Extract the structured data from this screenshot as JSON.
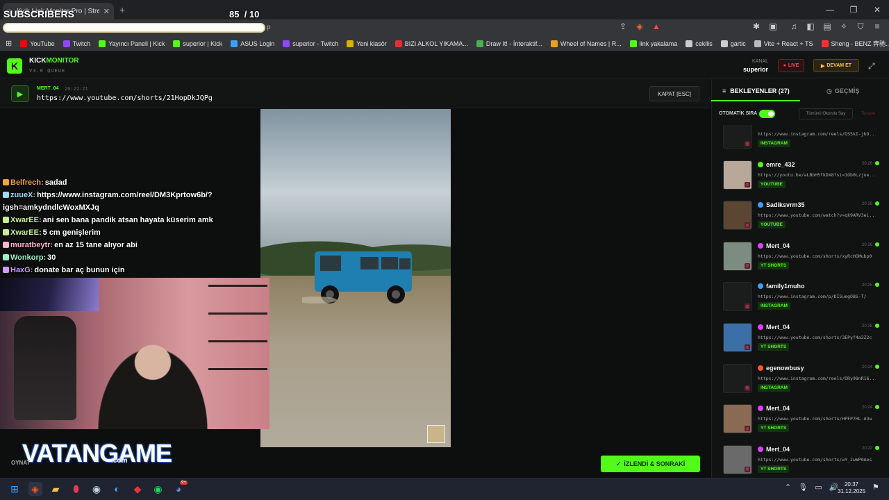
{
  "browser": {
    "tab_title": "Kick Link Monitor Pro | Strea",
    "address_tail": "p",
    "bookmarks": [
      "YouTube",
      "Twitch",
      "Yayıncı Paneli | Kick",
      "superior | Kick",
      "ASUS Login",
      "superior - Twitch",
      "Yeni klasör",
      "BIZI ALKOL YIKAMA...",
      "Draw It! - İnteraktif...",
      "Wheel of Names | R...",
      "link yakalama",
      "cekilis",
      "gartic",
      "Vite + React + TS",
      "Sheng - BENZ 奔驰..."
    ],
    "bookmark_colors": [
      "#ff0000",
      "#9146ff",
      "#53fc18",
      "#53fc18",
      "#3aa0ff",
      "#9146ff",
      "#d8b400",
      "#e03030",
      "#4caf50",
      "#e8a020",
      "#53fc18",
      "#cccccc",
      "#cccccc",
      "#bbbbbb",
      "#ff3030"
    ]
  },
  "overlay": {
    "subscribers_label": "SUBSCRIBERS",
    "subscribers_count": "85",
    "subscribers_goal": "/ 10",
    "watermark_main": "VATANGAME",
    "watermark_domain": ".com",
    "chat": [
      {
        "user": "Belfrech:",
        "msg": "sadad",
        "color": "#f3a23c"
      },
      {
        "user": "zuueX:",
        "msg": "https://www.instagram.com/reel/DM3Kprtow6b/?igsh=amkydndlcWoxMXJq",
        "color": "#9adcff"
      },
      {
        "user": "XwarEE:",
        "msg": "ani sen bana pandik atsan hayata küserim amk",
        "color": "#c8f08f"
      },
      {
        "user": "XwarEE:",
        "msg": "5 cm genişlerim",
        "color": "#c8f08f"
      },
      {
        "user": "muratbeytr:",
        "msg": "en az 15 tane alıyor abi",
        "color": "#ffb3d0"
      },
      {
        "user": "Wonkorp:",
        "msg": "30",
        "color": "#9af0c8"
      },
      {
        "user": "HaxG:",
        "msg": "donate bar aç bunun için",
        "color": "#d39aff"
      }
    ]
  },
  "app": {
    "brand_a": "KICK",
    "brand_b": "MONITOR",
    "version": "V3.0 QUEUE",
    "kanal_label": "KANAL",
    "kanal_value": "superior",
    "live_label": "LIVE",
    "devam_label": "DEVAM ET",
    "now_playing": {
      "user": "MERT_04",
      "time": "20:22:21",
      "url": "https://www.youtube.com/shorts/21HopDkJQPg"
    },
    "close_label": "KAPAT [ESC]",
    "oynat_label": "OYNAT",
    "next_label": "İZLENDİ & SONRAKİ"
  },
  "sidebar": {
    "tab_waiting": "BEKLEYENLER (27)",
    "tab_history": "GEÇMİŞ",
    "auto_label": "OTOMATİK SIRA",
    "auto_on": true,
    "mark_all_label": "Tümünü Okundu Say",
    "clear_label": "Temizle",
    "items": [
      {
        "user": "",
        "time": "",
        "url": "https://www.instagram.com/reels/DS5kI-jkO...",
        "tag": "INSTAGRAM",
        "platform": "#e1306c",
        "thumb": "#1a1d1c"
      },
      {
        "user": "emre_432",
        "time": "20:26",
        "url": "https://youtu.be/aLBbH5fkDX8?si=1Ob0Lzjue...",
        "tag": "YOUTUBE",
        "platform": "#53fc18",
        "thumb": "#b8a89a"
      },
      {
        "user": "Sadiksvrm35",
        "time": "20:26",
        "url": "https://www.youtube.com/watch?v=qk9ARV3ei...",
        "tag": "YOUTUBE",
        "platform": "#3aa0ff",
        "thumb": "#5b4632"
      },
      {
        "user": "Mert_04",
        "time": "20:26",
        "url": "https://www.youtube.com/shorts/xyRcHGMubp0",
        "tag": "YT SHORTS",
        "platform": "#e040fb",
        "thumb": "#7c8c82"
      },
      {
        "user": "family1muho",
        "time": "20:25",
        "url": "https://www.instagram.com/p/DISuegOBS-T/",
        "tag": "INSTAGRAM",
        "platform": "#3aa0ff",
        "thumb": "#1a1d1c"
      },
      {
        "user": "Mert_04",
        "time": "20:25",
        "url": "https://www.youtube.com/shorts/3EPyf4a3Z2c",
        "tag": "YT SHORTS",
        "platform": "#e040fb",
        "thumb": "#3b6fa8"
      },
      {
        "user": "egenowbusy",
        "time": "20:24",
        "url": "https://www.instagram.com/reels/DRy98nR16...",
        "tag": "INSTAGRAM",
        "platform": "#ff5722",
        "thumb": "#1a1d1c"
      },
      {
        "user": "Mert_04",
        "time": "20:24",
        "url": "https://www.youtube.com/shorts/HPFP7HL-A3w",
        "tag": "YT SHORTS",
        "platform": "#e040fb",
        "thumb": "#8a6a52"
      },
      {
        "user": "Mert_04",
        "time": "20:22",
        "url": "https://www.youtube.com/shorts/wY_2wWP0Aes",
        "tag": "YT SHORTS",
        "platform": "#e040fb",
        "thumb": "#6a6a6a"
      }
    ]
  },
  "taskbar": {
    "apps": [
      "windows-start",
      "brave",
      "files",
      "maps",
      "steam",
      "edge",
      "game",
      "spotify",
      "discord"
    ],
    "discord_badge": "9+",
    "time": "20:37",
    "date": "31.12.2025"
  },
  "colors": {
    "accent": "#53fc18",
    "bg": "#0d0f0e",
    "live": "#ff4b4b",
    "devam": "#f6c343"
  }
}
